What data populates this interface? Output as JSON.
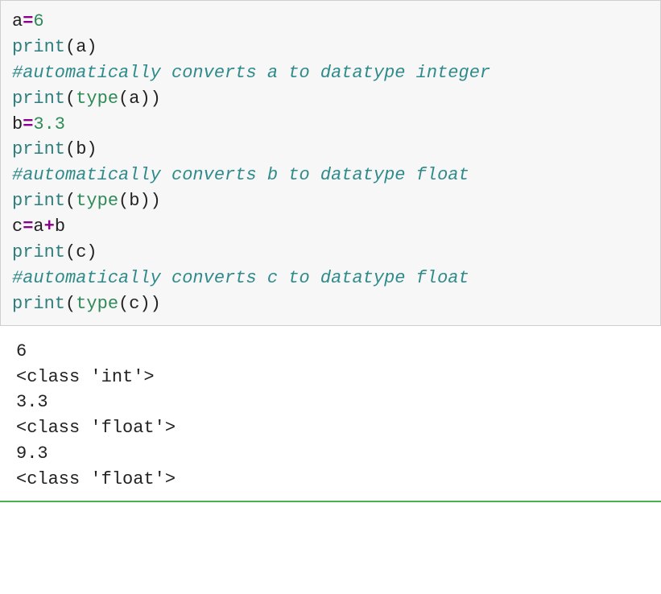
{
  "code": {
    "lines": [
      {
        "tokens": [
          {
            "t": "a",
            "c": "ident"
          },
          {
            "t": "=",
            "c": "op"
          },
          {
            "t": "6",
            "c": "num"
          }
        ]
      },
      {
        "tokens": [
          {
            "t": "print",
            "c": "func"
          },
          {
            "t": "(",
            "c": "paren"
          },
          {
            "t": "a",
            "c": "ident"
          },
          {
            "t": ")",
            "c": "paren"
          }
        ]
      },
      {
        "tokens": [
          {
            "t": "#automatically converts a to datatype integer",
            "c": "comment"
          }
        ]
      },
      {
        "tokens": [
          {
            "t": "print",
            "c": "func"
          },
          {
            "t": "(",
            "c": "paren"
          },
          {
            "t": "type",
            "c": "builtin"
          },
          {
            "t": "(",
            "c": "paren"
          },
          {
            "t": "a",
            "c": "ident"
          },
          {
            "t": ")",
            "c": "paren"
          },
          {
            "t": ")",
            "c": "paren"
          }
        ]
      },
      {
        "tokens": [
          {
            "t": "b",
            "c": "ident"
          },
          {
            "t": "=",
            "c": "op"
          },
          {
            "t": "3.3",
            "c": "num"
          }
        ]
      },
      {
        "tokens": [
          {
            "t": "print",
            "c": "func"
          },
          {
            "t": "(",
            "c": "paren"
          },
          {
            "t": "b",
            "c": "ident"
          },
          {
            "t": ")",
            "c": "paren"
          }
        ]
      },
      {
        "tokens": [
          {
            "t": "#automatically converts b to datatype float",
            "c": "comment"
          }
        ]
      },
      {
        "tokens": [
          {
            "t": "print",
            "c": "func"
          },
          {
            "t": "(",
            "c": "paren"
          },
          {
            "t": "type",
            "c": "builtin"
          },
          {
            "t": "(",
            "c": "paren"
          },
          {
            "t": "b",
            "c": "ident"
          },
          {
            "t": ")",
            "c": "paren"
          },
          {
            "t": ")",
            "c": "paren"
          }
        ]
      },
      {
        "tokens": [
          {
            "t": "c",
            "c": "ident"
          },
          {
            "t": "=",
            "c": "op"
          },
          {
            "t": "a",
            "c": "ident"
          },
          {
            "t": "+",
            "c": "op"
          },
          {
            "t": "b",
            "c": "ident"
          }
        ]
      },
      {
        "tokens": [
          {
            "t": "print",
            "c": "func"
          },
          {
            "t": "(",
            "c": "paren"
          },
          {
            "t": "c",
            "c": "ident"
          },
          {
            "t": ")",
            "c": "paren"
          }
        ]
      },
      {
        "tokens": [
          {
            "t": "#automatically converts c to datatype float",
            "c": "comment"
          }
        ]
      },
      {
        "tokens": [
          {
            "t": "print",
            "c": "func"
          },
          {
            "t": "(",
            "c": "paren"
          },
          {
            "t": "type",
            "c": "builtin"
          },
          {
            "t": "(",
            "c": "paren"
          },
          {
            "t": "c",
            "c": "ident"
          },
          {
            "t": ")",
            "c": "paren"
          },
          {
            "t": ")",
            "c": "paren"
          }
        ]
      }
    ]
  },
  "output": {
    "lines": [
      "6",
      "<class 'int'>",
      "3.3",
      "<class 'float'>",
      "9.3",
      "<class 'float'>"
    ]
  }
}
